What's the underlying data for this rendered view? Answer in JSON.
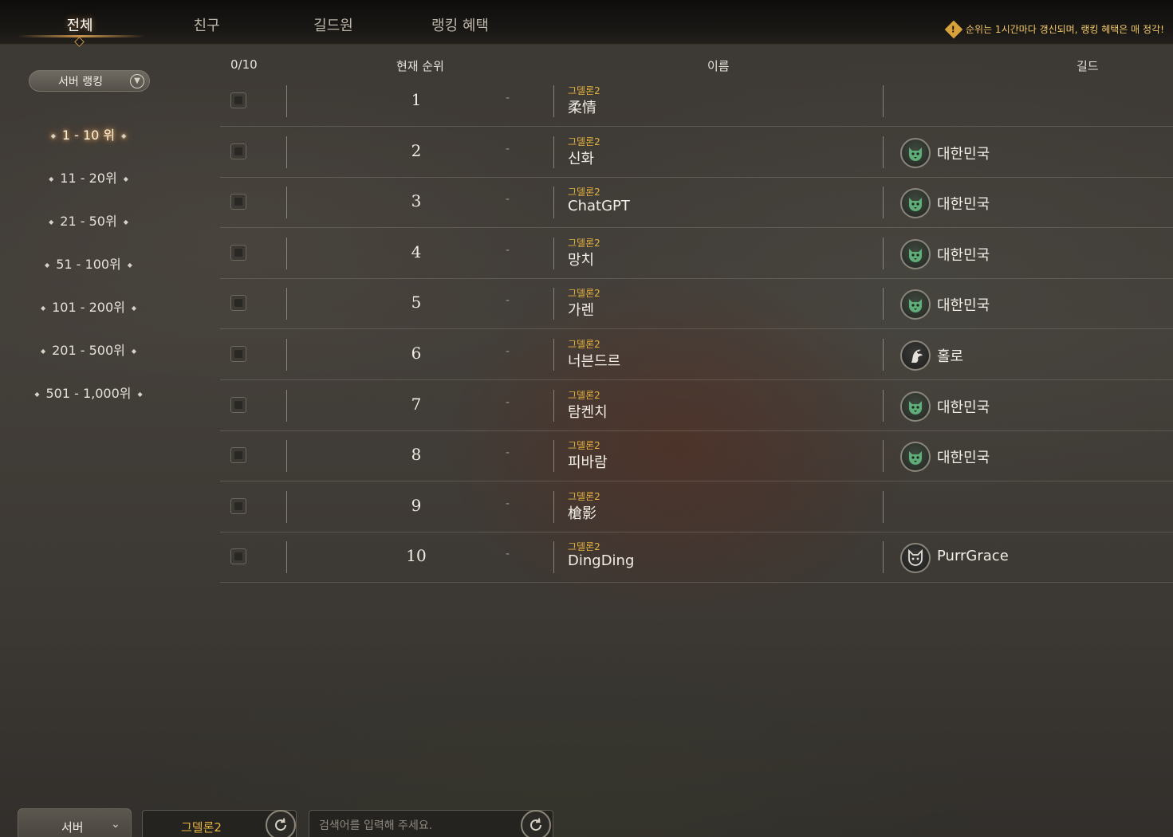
{
  "tabs": [
    {
      "label": "전체",
      "active": true
    },
    {
      "label": "친구",
      "active": false
    },
    {
      "label": "길드원",
      "active": false
    },
    {
      "label": "랭킹 혜택",
      "active": false
    }
  ],
  "notice": {
    "icon": "!",
    "text": "순위는 1시간마다 갱신되며, 랭킹 혜택은 매 정각!"
  },
  "sidebar": {
    "dropdown_label": "서버 랭킹",
    "ranges": [
      {
        "label": "1 - 10 위",
        "active": true
      },
      {
        "label": "11 - 20위",
        "active": false
      },
      {
        "label": "21 - 50위",
        "active": false
      },
      {
        "label": "51 - 100위",
        "active": false
      },
      {
        "label": "101 - 200위",
        "active": false
      },
      {
        "label": "201 - 500위",
        "active": false
      },
      {
        "label": "501 - 1,000위",
        "active": false
      }
    ]
  },
  "table": {
    "headers": {
      "count": "0/10",
      "rank": "현재 순위",
      "name": "이름",
      "guild": "길드"
    },
    "rows": [
      {
        "rank": "1",
        "change": "-",
        "server": "그델론2",
        "name": "柔情",
        "guild": "",
        "guild_icon": ""
      },
      {
        "rank": "2",
        "change": "-",
        "server": "그델론2",
        "name": "신화",
        "guild": "대한민국",
        "guild_icon": "tiger-icon"
      },
      {
        "rank": "3",
        "change": "-",
        "server": "그델론2",
        "name": "ChatGPT",
        "guild": "대한민국",
        "guild_icon": "tiger-icon"
      },
      {
        "rank": "4",
        "change": "-",
        "server": "그델론2",
        "name": "망치",
        "guild": "대한민국",
        "guild_icon": "tiger-icon"
      },
      {
        "rank": "5",
        "change": "-",
        "server": "그델론2",
        "name": "가렌",
        "guild": "대한민국",
        "guild_icon": "tiger-icon"
      },
      {
        "rank": "6",
        "change": "-",
        "server": "그델론2",
        "name": "너븐드르",
        "guild": "홀로",
        "guild_icon": "dragon-icon"
      },
      {
        "rank": "7",
        "change": "-",
        "server": "그델론2",
        "name": "탐켄치",
        "guild": "대한민국",
        "guild_icon": "tiger-icon"
      },
      {
        "rank": "8",
        "change": "-",
        "server": "그델론2",
        "name": "피바람",
        "guild": "대한민국",
        "guild_icon": "tiger-icon"
      },
      {
        "rank": "9",
        "change": "-",
        "server": "그델론2",
        "name": "槍影",
        "guild": "",
        "guild_icon": ""
      },
      {
        "rank": "10",
        "change": "-",
        "server": "그델론2",
        "name": "DingDing",
        "guild": "PurrGrace",
        "guild_icon": "cat-icon"
      }
    ]
  },
  "bottom": {
    "server_label": "서버",
    "realm_label": "그델론2",
    "search_placeholder": "검색어를 입력해 주세요."
  },
  "colors": {
    "accent_gold": "#e6b33f",
    "tiger_green": "#5fae7a"
  }
}
